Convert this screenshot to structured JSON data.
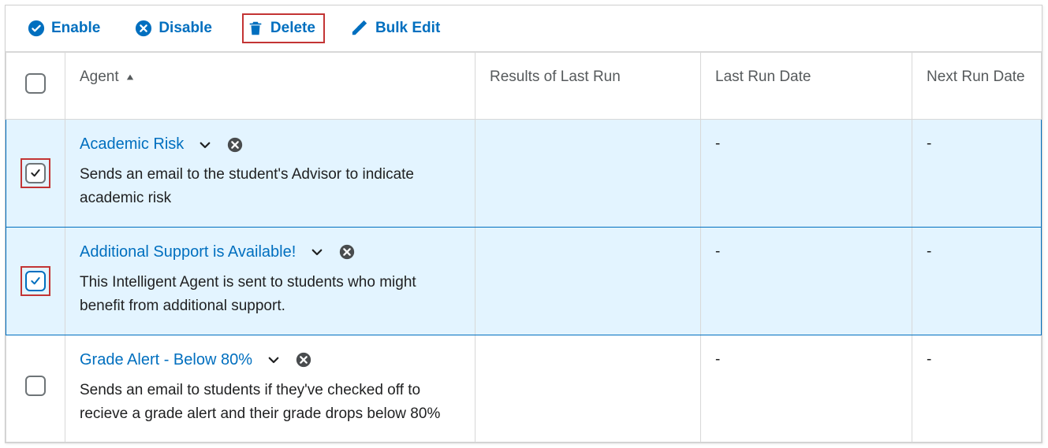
{
  "toolbar": {
    "enable": {
      "label": "Enable"
    },
    "disable": {
      "label": "Disable"
    },
    "delete": {
      "label": "Delete"
    },
    "bulkedit": {
      "label": "Bulk Edit"
    }
  },
  "columns": {
    "agent": "Agent",
    "results": "Results of Last Run",
    "last": "Last Run Date",
    "next": "Next Run Date"
  },
  "rows": [
    {
      "title": "Academic Risk",
      "desc": "Sends an email to the student's Advisor to indicate academic risk",
      "last": "-",
      "next": "-"
    },
    {
      "title": "Additional Support is Available!",
      "desc": "This Intelligent Agent is sent to students who might benefit from additional support.",
      "last": "-",
      "next": "-"
    },
    {
      "title": "Grade Alert - Below 80%",
      "desc": "Sends an email to students if they've checked off to recieve a grade alert and their grade drops below 80%",
      "last": "-",
      "next": "-"
    }
  ]
}
